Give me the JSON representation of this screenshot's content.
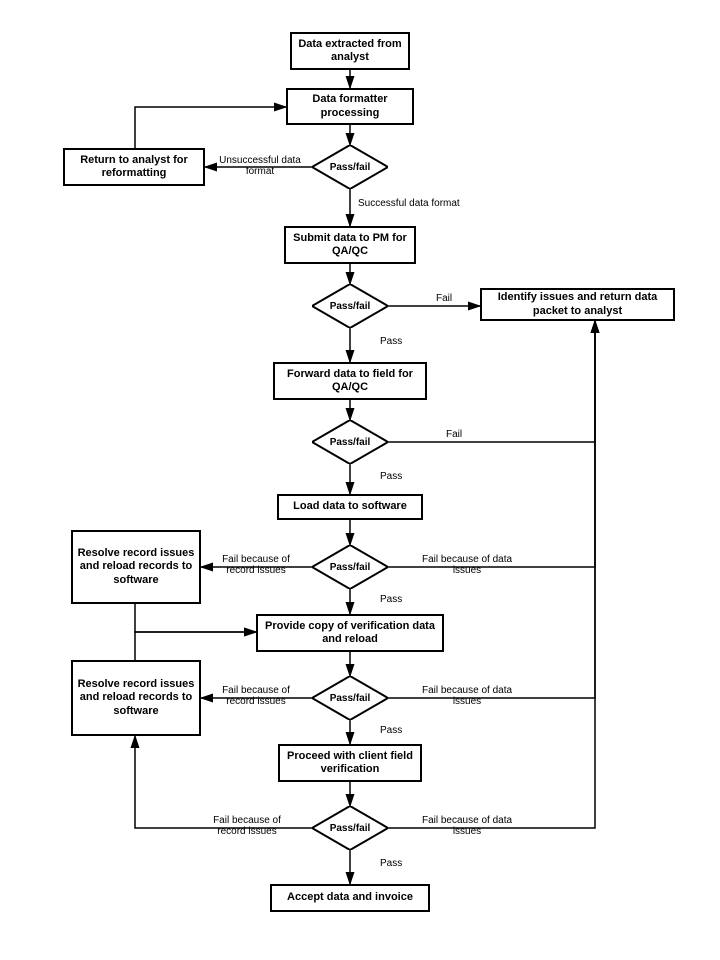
{
  "nodes": {
    "n1": "Data extracted from analyst",
    "n2": "Data formatter processing",
    "n3": "Return to analyst for reformatting",
    "n4": "Submit data to PM for QA/QC",
    "n5": "Identify issues and return data packet to analyst",
    "n6": "Forward data to field for QA/QC",
    "n7": "Load data to software",
    "n8a": "Resolve record issues and reload records to software",
    "n8b": "Resolve record issues and reload records to software",
    "n9": "Provide copy of verification data and reload",
    "n10": "Proceed with client field verification",
    "n11": "Accept data and invoice"
  },
  "decisions": {
    "d1": "Pass/fail",
    "d2": "Pass/fail",
    "d3": "Pass/fail",
    "d4": "Pass/fail",
    "d5": "Pass/fail",
    "d6": "Pass/fail"
  },
  "labels": {
    "l1a": "Unsuccessful data format",
    "l1b": "Successful data format",
    "l2_fail": "Fail",
    "l2_pass": "Pass",
    "l3_fail": "Fail",
    "l3_pass": "Pass",
    "l4_failL": "Fail because of record issues",
    "l4_failR": "Fail because of data issues",
    "l4_pass": "Pass",
    "l5_failL": "Fail because of record issues",
    "l5_failR": "Fail because of data issues",
    "l5_pass": "Pass",
    "l6_failL": "Fail because of record issues",
    "l6_failR": "Fail because of data issues",
    "l6_pass": "Pass"
  }
}
